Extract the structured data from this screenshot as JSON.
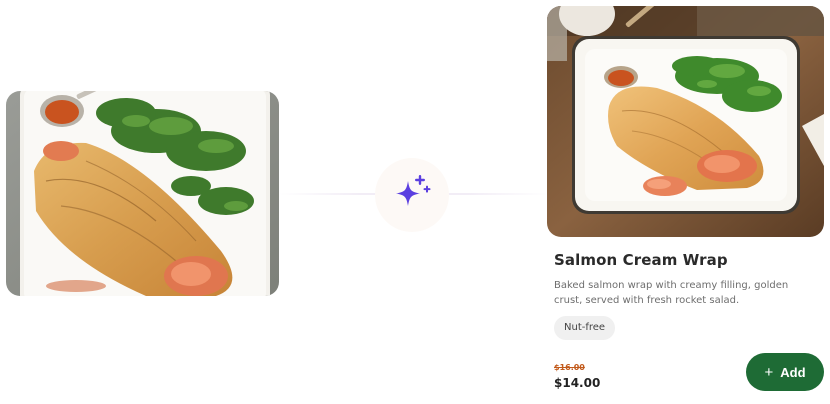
{
  "dish": {
    "title": "Salmon Cream Wrap",
    "description": "Baked salmon wrap with creamy filling, golden crust, served with fresh rocket salad.",
    "tag": "Nut-free",
    "price_original": "$16.00",
    "price_current": "$14.00"
  },
  "actions": {
    "add_label": "Add",
    "add_icon": "plus-icon"
  },
  "icons": {
    "enhance": "sparkle-icon"
  },
  "colors": {
    "accent_green": "#1e6b35",
    "sparkle_purple": "#5b3fe0",
    "old_price": "#c25a1b"
  }
}
